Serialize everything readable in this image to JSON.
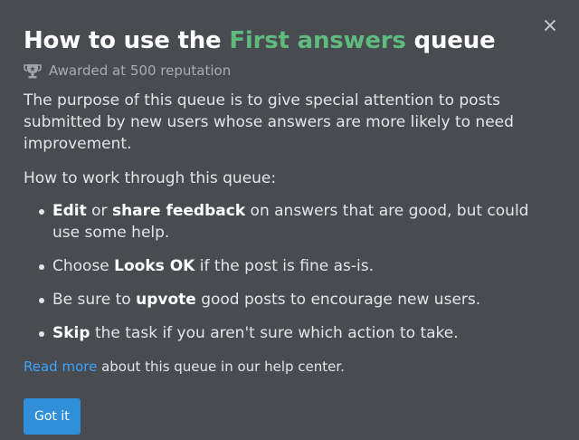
{
  "modal": {
    "title_prefix": "How to use the ",
    "title_queue": "First answers",
    "title_suffix": " queue",
    "award_text": "Awarded at 500 reputation",
    "purpose": "The purpose of this queue is to give special attention to posts submitted by new users whose answers are more likely to need improvement.",
    "how_intro": "How to work through this queue:",
    "steps": [
      {
        "b1": "Edit",
        "t1": " or ",
        "b2": "share feedback",
        "t2": " on answers that are good, but could use some help."
      },
      {
        "t0": "Choose ",
        "b1": "Looks OK",
        "t1": " if the post is fine as-is."
      },
      {
        "t0": "Be sure to ",
        "b1": "upvote",
        "t1": " good posts to encourage new users."
      },
      {
        "b1": "Skip",
        "t1": " the task if you aren't sure which action to take."
      }
    ],
    "help_link": "Read more",
    "help_text": " about this queue in our help center.",
    "button_label": "Got it",
    "close_label": "×"
  },
  "colors": {
    "background": "#484b4f",
    "accent_green": "#5eba7d",
    "link_blue": "#3ca4ff",
    "button_blue": "#318ed8"
  }
}
